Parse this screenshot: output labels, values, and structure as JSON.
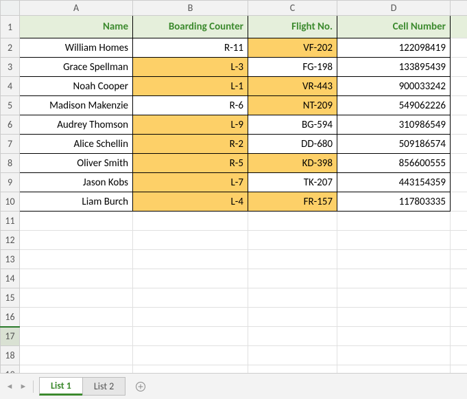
{
  "columns": [
    "A",
    "B",
    "C",
    "D",
    ""
  ],
  "headers": {
    "A": "Name",
    "B": "Boarding Counter",
    "C": "Flight No.",
    "D": "Cell Number"
  },
  "rows": [
    {
      "A": "William Homes",
      "B": "R-11",
      "C": "VF-202",
      "D": "122098419",
      "hl": {
        "B": false,
        "C": true
      }
    },
    {
      "A": "Grace Spellman",
      "B": "L-3",
      "C": "FG-198",
      "D": "133895439",
      "hl": {
        "B": true,
        "C": false
      }
    },
    {
      "A": "Noah Cooper",
      "B": "L-1",
      "C": "VR-443",
      "D": "900033242",
      "hl": {
        "B": true,
        "C": true
      }
    },
    {
      "A": "Madison Makenzie",
      "B": "R-6",
      "C": "NT-209",
      "D": "549062226",
      "hl": {
        "B": false,
        "C": true
      }
    },
    {
      "A": "Audrey Thomson",
      "B": "L-9",
      "C": "BG-594",
      "D": "310986549",
      "hl": {
        "B": true,
        "C": false
      }
    },
    {
      "A": "Alice Schellin",
      "B": "R-2",
      "C": "DD-680",
      "D": "509186574",
      "hl": {
        "B": true,
        "C": false
      }
    },
    {
      "A": "Oliver Smith",
      "B": "R-5",
      "C": "KD-398",
      "D": "856600555",
      "hl": {
        "B": true,
        "C": true
      }
    },
    {
      "A": "Jason Kobs",
      "B": "L-7",
      "C": "TK-207",
      "D": "443154359",
      "hl": {
        "B": true,
        "C": false
      }
    },
    {
      "A": "Liam Burch",
      "B": "L-4",
      "C": "FR-157",
      "D": "117803335",
      "hl": {
        "B": true,
        "C": true
      }
    }
  ],
  "total_visible_rows": 19,
  "selected_row": 17,
  "tabs": {
    "items": [
      "List 1",
      "List 2"
    ],
    "active": 0
  },
  "chart_data": {
    "type": "table",
    "title": "",
    "columns": [
      "Name",
      "Boarding Counter",
      "Flight No.",
      "Cell Number"
    ],
    "data": [
      [
        "William Homes",
        "R-11",
        "VF-202",
        122098419
      ],
      [
        "Grace Spellman",
        "L-3",
        "FG-198",
        133895439
      ],
      [
        "Noah Cooper",
        "L-1",
        "VR-443",
        900033242
      ],
      [
        "Madison Makenzie",
        "R-6",
        "NT-209",
        549062226
      ],
      [
        "Audrey Thomson",
        "L-9",
        "BG-594",
        310986549
      ],
      [
        "Alice Schellin",
        "R-2",
        "DD-680",
        509186574
      ],
      [
        "Oliver Smith",
        "R-5",
        "KD-398",
        856600555
      ],
      [
        "Jason Kobs",
        "L-7",
        "TK-207",
        443154359
      ],
      [
        "Liam Burch",
        "L-4",
        "FR-157",
        117803335
      ]
    ]
  }
}
